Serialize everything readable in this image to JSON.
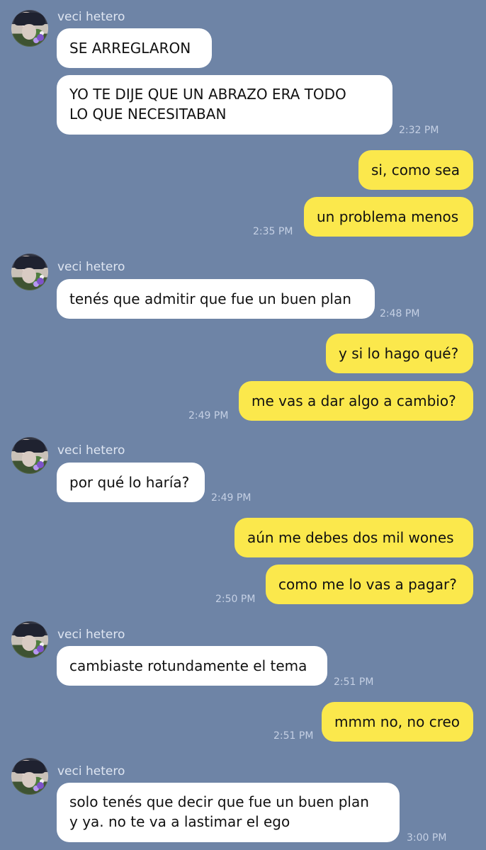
{
  "chat": {
    "contact_name": "veci hetero",
    "messages": [
      {
        "id": 0,
        "from": "contact",
        "text": "SE ARREGLARON",
        "time": ""
      },
      {
        "id": 1,
        "from": "contact",
        "text": "YO TE DIJE QUE UN ABRAZO ERA TODO\nLO QUE NECESITABAN",
        "time": "2:32 PM"
      },
      {
        "id": 2,
        "from": "me",
        "text": "si, como sea",
        "time": ""
      },
      {
        "id": 3,
        "from": "me",
        "text": "un problema menos",
        "time": "2:35 PM"
      },
      {
        "id": 4,
        "from": "contact",
        "text": "tenés que admitir que fue un buen plan",
        "time": "2:48 PM"
      },
      {
        "id": 5,
        "from": "me",
        "text": "y si lo hago qué?",
        "time": ""
      },
      {
        "id": 6,
        "from": "me",
        "text": "me vas a dar algo a cambio?",
        "time": "2:49 PM"
      },
      {
        "id": 7,
        "from": "contact",
        "text": "por qué lo haría?",
        "time": "2:49 PM"
      },
      {
        "id": 8,
        "from": "me",
        "text": "aún me debes dos mil wones",
        "time": ""
      },
      {
        "id": 9,
        "from": "me",
        "text": "como me lo vas a pagar?",
        "time": "2:50 PM"
      },
      {
        "id": 10,
        "from": "contact",
        "text": "cambiaste rotundamente el tema",
        "time": "2:51 PM"
      },
      {
        "id": 11,
        "from": "me",
        "text": "mmm no, no creo",
        "time": "2:51 PM"
      },
      {
        "id": 12,
        "from": "contact",
        "text": "solo tenés que decir que fue un buen plan\ny ya. no te va a lastimar el ego",
        "time": "3:00 PM"
      }
    ]
  },
  "colors": {
    "background": "#6e84a6",
    "incoming_bubble": "#ffffff",
    "outgoing_bubble": "#fbe84c"
  },
  "icons": {
    "avatar": "contact-avatar-photo"
  }
}
